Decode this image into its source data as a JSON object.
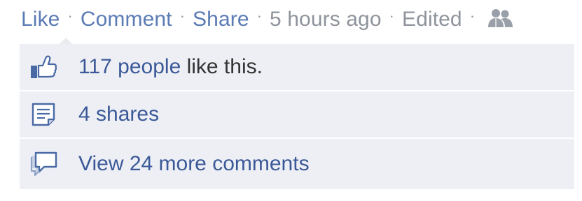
{
  "actions": {
    "like_label": "Like",
    "comment_label": "Comment",
    "share_label": "Share",
    "timestamp": "5 hours ago",
    "edited_label": "Edited",
    "separator": "·",
    "audience_icon": "friends-icon"
  },
  "summary": {
    "likes": {
      "count_link": "117 people",
      "suffix": " like this.",
      "icon": "thumbs-up-icon"
    },
    "shares": {
      "label": "4 shares",
      "icon": "share-document-icon"
    },
    "comments": {
      "label": "View 24 more comments",
      "icon": "comment-bubble-icon"
    }
  },
  "colors": {
    "link": "#3b5998",
    "action_link": "#5b7bb4",
    "muted": "#8f949c",
    "panel_bg": "#edeff4"
  }
}
